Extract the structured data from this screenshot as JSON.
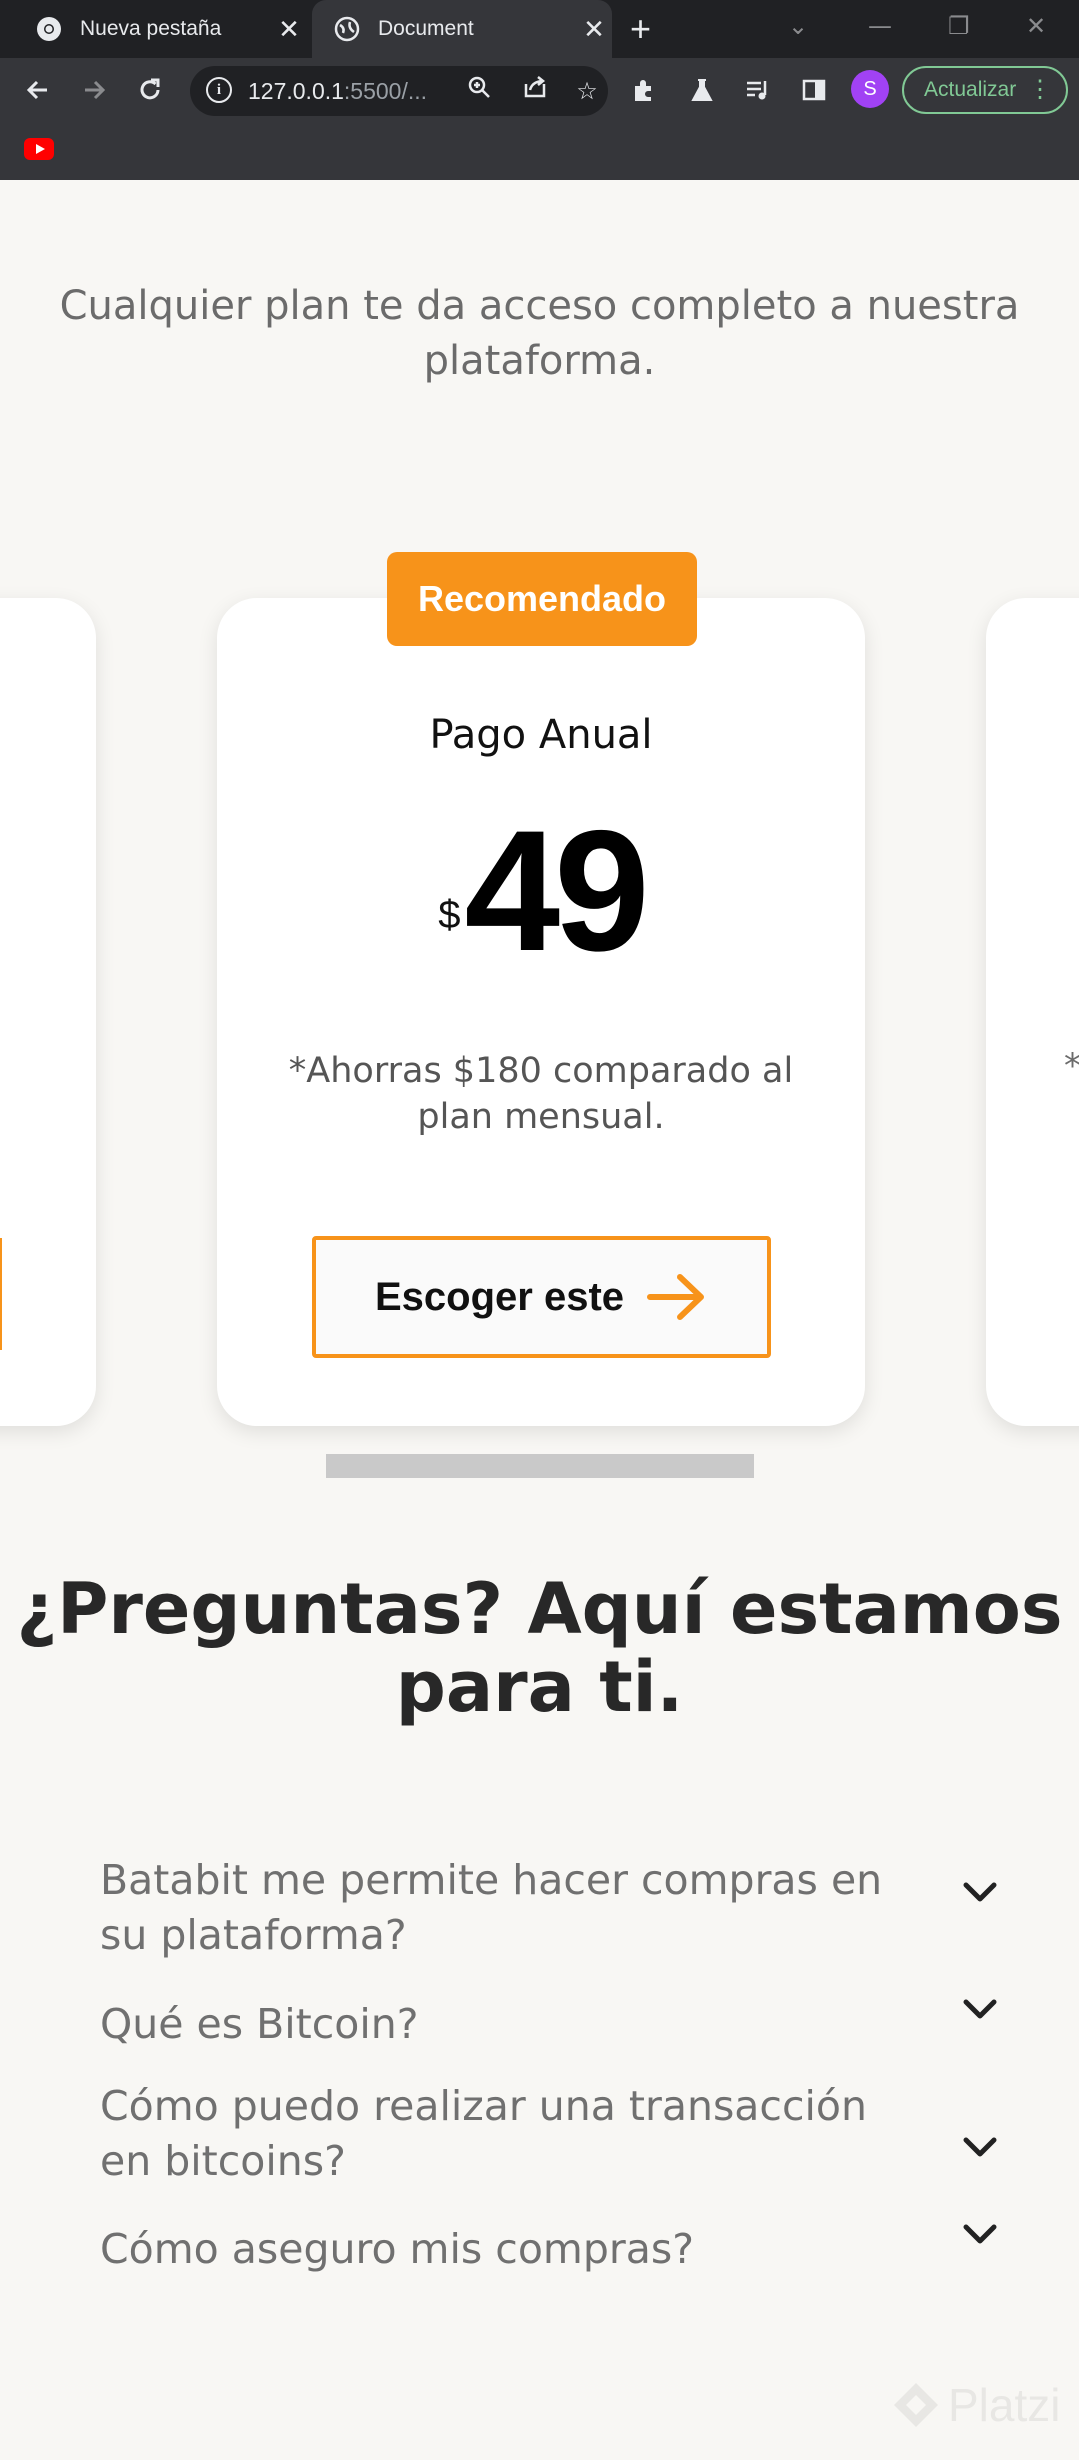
{
  "browser": {
    "tabs": [
      {
        "title": "Nueva pestaña",
        "active": false,
        "icon": "chrome-icon"
      },
      {
        "title": "Document",
        "active": true,
        "icon": "globe-icon"
      }
    ],
    "url_host": "127.0.0.1",
    "url_rest": ":5500/...",
    "avatar_letter": "S",
    "update_label": "Actualizar",
    "accent_green": "#81c995",
    "avatar_color": "#a142f4",
    "bookmark_icon": "youtube-icon"
  },
  "page": {
    "intro": "Cualquier plan te da acceso completo a nuestra plataforma.",
    "badge": "Recomendado",
    "plan": {
      "name": "Pago Anual",
      "currency": "$",
      "price": "49",
      "savings": "*Ahorras $180 comparado al plan mensual.",
      "cta": "Escoger este"
    },
    "right_card_star": "*",
    "accent": "#f7931a",
    "faq_title": "¿Preguntas? Aquí estamos para ti.",
    "faq": [
      "Batabit me permite hacer compras en su plataforma?",
      "Qué es Bitcoin?",
      "Cómo puedo realizar una transacción en bitcoins?",
      "Cómo aseguro mis compras?"
    ],
    "watermark": "Platzi"
  }
}
